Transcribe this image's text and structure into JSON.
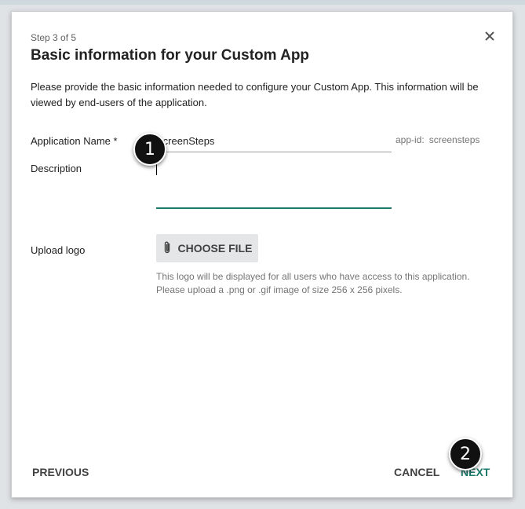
{
  "dialog": {
    "step": "Step 3 of 5",
    "title": "Basic information for your Custom App",
    "intro": "Please provide the basic information needed to configure your Custom App. This information will be viewed by end-users of the application."
  },
  "form": {
    "app_name_label": "Application Name *",
    "app_name_value": "ScreenSteps",
    "app_id_label": "app-id:",
    "app_id_value": "screensteps",
    "description_label": "Description",
    "description_value": "",
    "upload_label": "Upload logo",
    "choose_file_label": "CHOOSE FILE",
    "upload_hint": "This logo will be displayed for all users who have access to this application. Please upload a .png or .gif image of size 256 x 256 pixels."
  },
  "footer": {
    "previous_label": "PREVIOUS",
    "cancel_label": "CANCEL",
    "next_label": "NEXT"
  },
  "callouts": [
    "1",
    "2"
  ],
  "colors": {
    "accent": "#1b7a6a"
  },
  "icons": {
    "close": "close-icon",
    "attach": "paperclip-icon"
  }
}
